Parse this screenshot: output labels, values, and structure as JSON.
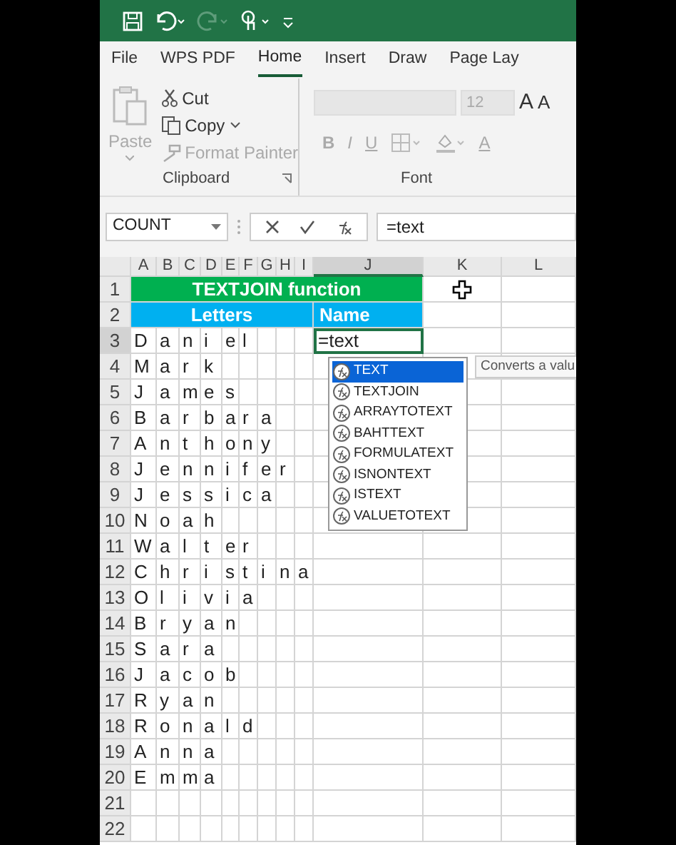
{
  "ribbon_tabs": [
    {
      "label": "File",
      "selected": false
    },
    {
      "label": "WPS PDF",
      "selected": false
    },
    {
      "label": "Home",
      "selected": true
    },
    {
      "label": "Insert",
      "selected": false
    },
    {
      "label": "Draw",
      "selected": false
    },
    {
      "label": "Page Lay",
      "selected": false
    }
  ],
  "clipboard": {
    "items": [
      {
        "label": "Paste",
        "disabled": true
      },
      {
        "label": "Cut",
        "disabled": false
      },
      {
        "label": "Copy",
        "disabled": false
      },
      {
        "label": "Format Painter",
        "disabled": true
      }
    ],
    "group_label": "Clipboard"
  },
  "font": {
    "font_size": "12",
    "format_buttons": [
      "B",
      "I",
      "U"
    ],
    "grow_font": "A",
    "shrink_font": "A",
    "font_color": "A",
    "group_label": "Font"
  },
  "name_box": "COUNT",
  "formula": "=text",
  "sheet": {
    "columns": [
      "A",
      "B",
      "C",
      "D",
      "E",
      "F",
      "G",
      "H",
      "I",
      "J",
      "K",
      "L"
    ],
    "title_row": {
      "number": "1",
      "text": "TEXTJOIN function"
    },
    "header_row": {
      "number": "2",
      "letters": "Letters",
      "name": "Name"
    },
    "rows": [
      {
        "number": "3",
        "letters": [
          "D",
          "a",
          "n",
          "i",
          "e",
          "l"
        ],
        "name": "=text"
      },
      {
        "number": "4",
        "letters": [
          "M",
          "a",
          "r",
          "k"
        ]
      },
      {
        "number": "5",
        "letters": [
          "J",
          "a",
          "m",
          "e",
          "s"
        ]
      },
      {
        "number": "6",
        "letters": [
          "B",
          "a",
          "r",
          "b",
          "a",
          "r",
          "a"
        ]
      },
      {
        "number": "7",
        "letters": [
          "A",
          "n",
          "t",
          "h",
          "o",
          "n",
          "y"
        ]
      },
      {
        "number": "8",
        "letters": [
          "J",
          "e",
          "n",
          "n",
          "i",
          "f",
          "e",
          "r"
        ]
      },
      {
        "number": "9",
        "letters": [
          "J",
          "e",
          "s",
          "s",
          "i",
          "c",
          "a"
        ]
      },
      {
        "number": "10",
        "letters": [
          "N",
          "o",
          "a",
          "h"
        ]
      },
      {
        "number": "11",
        "letters": [
          "W",
          "a",
          "l",
          "t",
          "e",
          "r"
        ]
      },
      {
        "number": "12",
        "letters": [
          "C",
          "h",
          "r",
          "i",
          "s",
          "t",
          "i",
          "n",
          "a"
        ]
      },
      {
        "number": "13",
        "letters": [
          "O",
          "l",
          "i",
          "v",
          "i",
          "a"
        ]
      },
      {
        "number": "14",
        "letters": [
          "B",
          "r",
          "y",
          "a",
          "n"
        ]
      },
      {
        "number": "15",
        "letters": [
          "S",
          "a",
          "r",
          "a"
        ]
      },
      {
        "number": "16",
        "letters": [
          "J",
          "a",
          "c",
          "o",
          "b"
        ]
      },
      {
        "number": "17",
        "letters": [
          "R",
          "y",
          "a",
          "n"
        ]
      },
      {
        "number": "18",
        "letters": [
          "R",
          "o",
          "n",
          "a",
          "l",
          "d"
        ]
      },
      {
        "number": "19",
        "letters": [
          "A",
          "n",
          "n",
          "a"
        ]
      },
      {
        "number": "20",
        "letters": [
          "E",
          "m",
          "m",
          "a"
        ]
      },
      {
        "number": "21",
        "letters": []
      },
      {
        "number": "22",
        "letters": []
      }
    ]
  },
  "autocomplete": {
    "items": [
      {
        "label": "TEXT",
        "selected": true
      },
      {
        "label": "TEXTJOIN",
        "selected": false
      },
      {
        "label": "ARRAYTOTEXT",
        "selected": false
      },
      {
        "label": "BAHTTEXT",
        "selected": false
      },
      {
        "label": "FORMULATEXT",
        "selected": false
      },
      {
        "label": "ISNONTEXT",
        "selected": false
      },
      {
        "label": "ISTEXT",
        "selected": false
      },
      {
        "label": "VALUETOTEXT",
        "selected": false
      }
    ],
    "tooltip": "Converts a valu"
  }
}
